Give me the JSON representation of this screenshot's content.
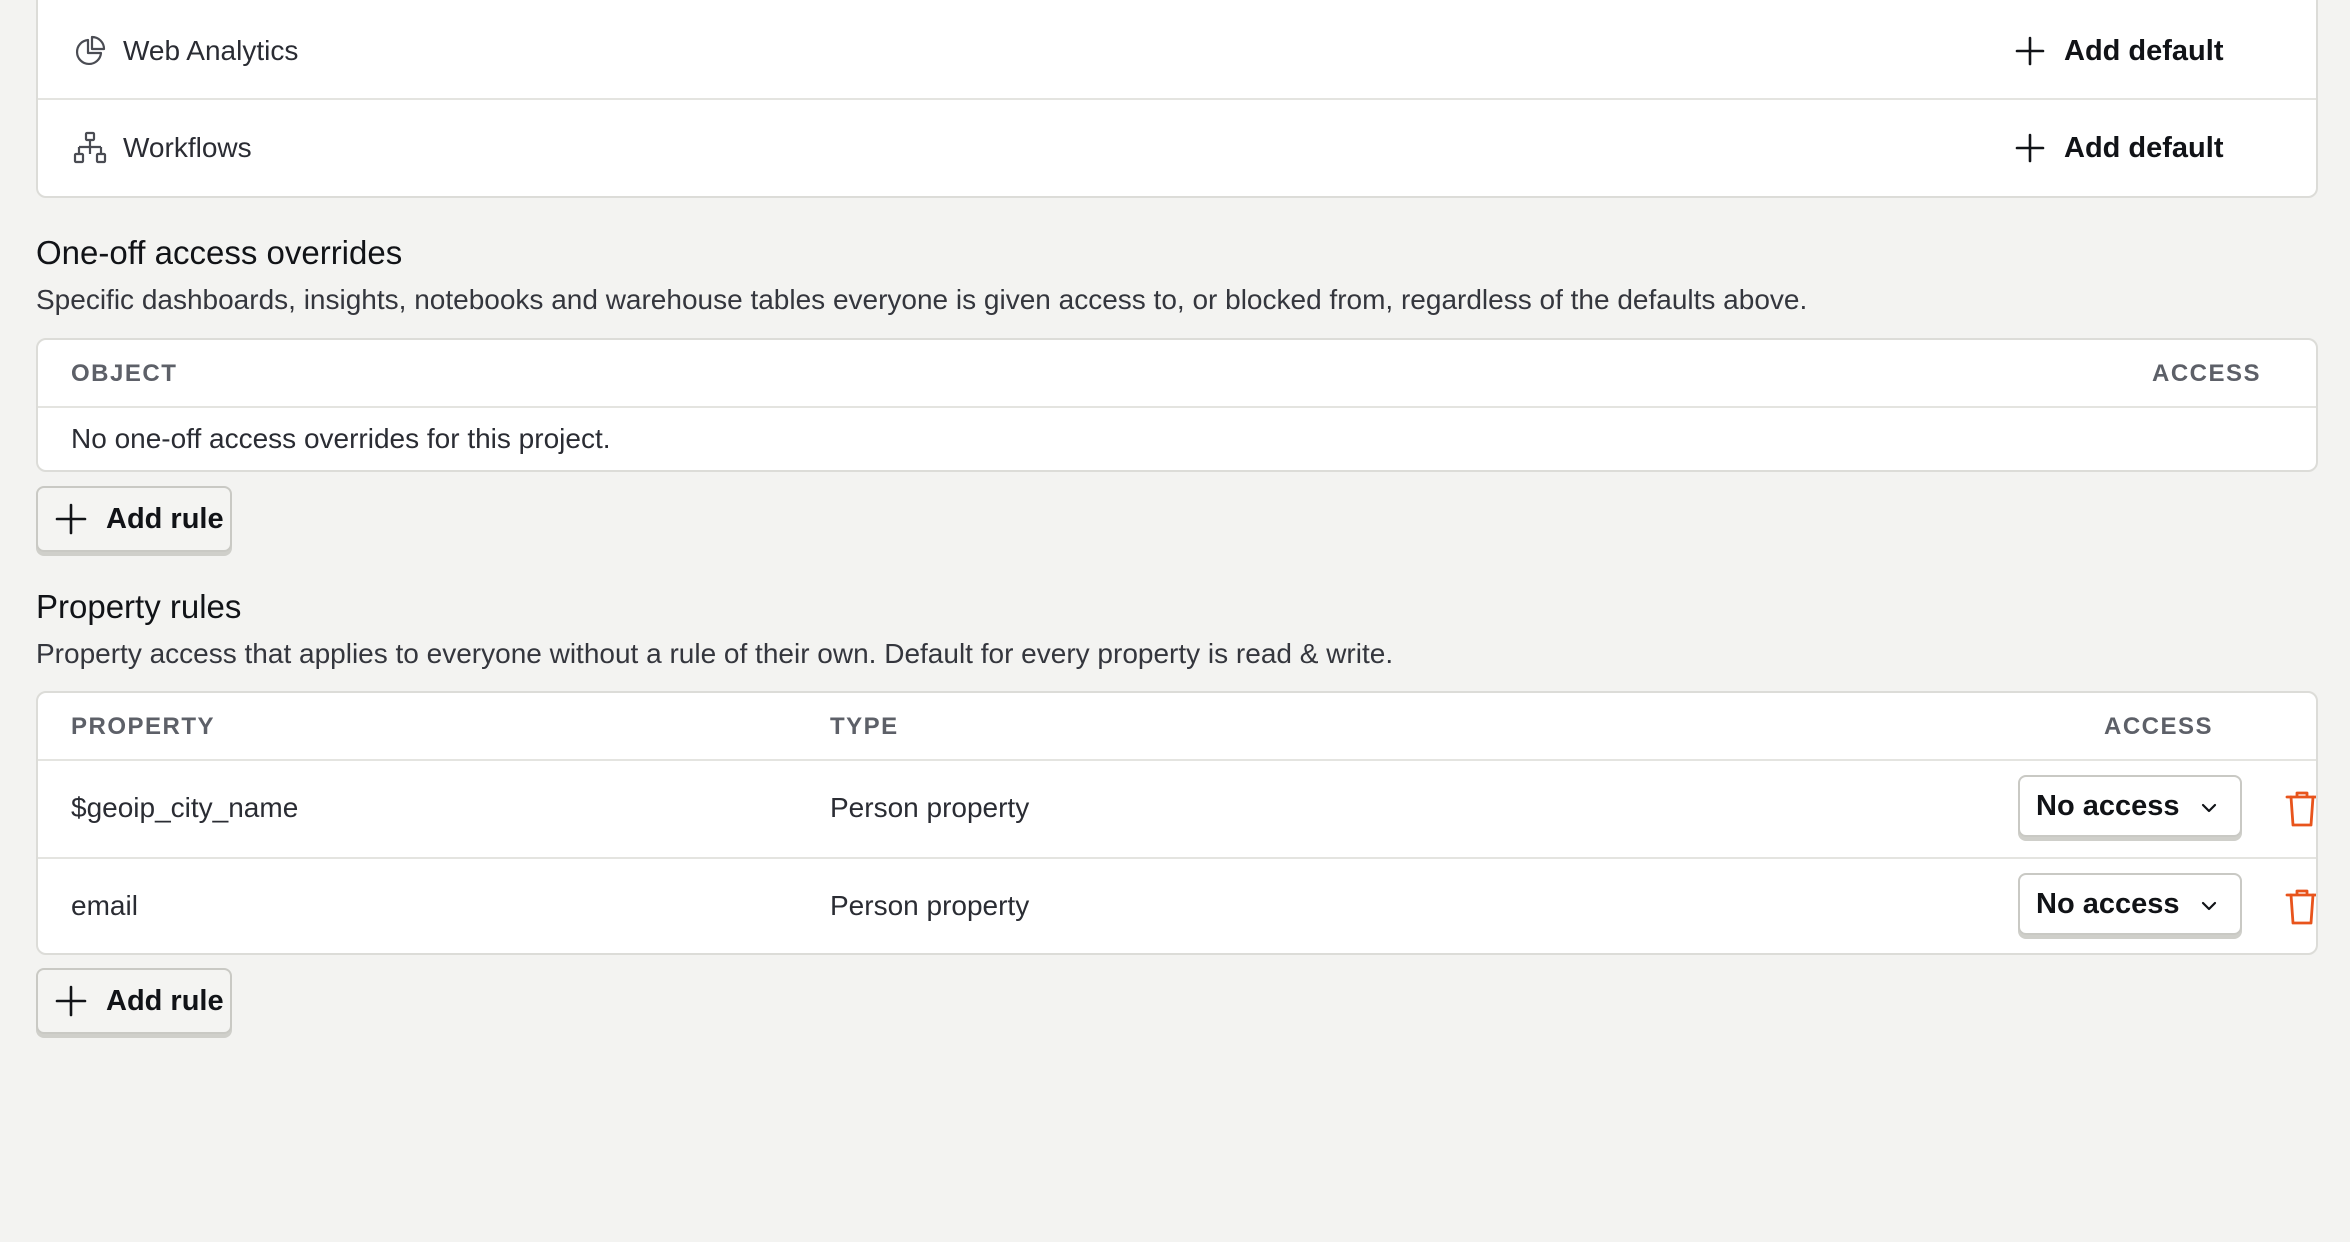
{
  "products": [
    {
      "label": "Web Analytics",
      "icon": "pie-chart-icon",
      "action": "Add default"
    },
    {
      "label": "Workflows",
      "icon": "workflow-icon",
      "action": "Add default"
    }
  ],
  "overrides": {
    "title": "One-off access overrides",
    "description": "Specific dashboards, insights, notebooks and warehouse tables everyone is given access to, or blocked from, regardless of the defaults above.",
    "columns": {
      "object": "OBJECT",
      "access": "ACCESS"
    },
    "empty_text": "No one-off access overrides for this project.",
    "add_label": "Add rule"
  },
  "property_rules": {
    "title": "Property rules",
    "description": "Property access that applies to everyone without a rule of their own. Default for every property is read & write.",
    "columns": {
      "property": "PROPERTY",
      "type": "TYPE",
      "access": "ACCESS"
    },
    "rows": [
      {
        "property": "$geoip_city_name",
        "type": "Person property",
        "access": "No access"
      },
      {
        "property": "email",
        "type": "Person property",
        "access": "No access"
      }
    ],
    "add_label": "Add rule"
  },
  "colors": {
    "background": "#f3f3f1",
    "danger": "#e8541c",
    "border": "#dcdcd8"
  }
}
